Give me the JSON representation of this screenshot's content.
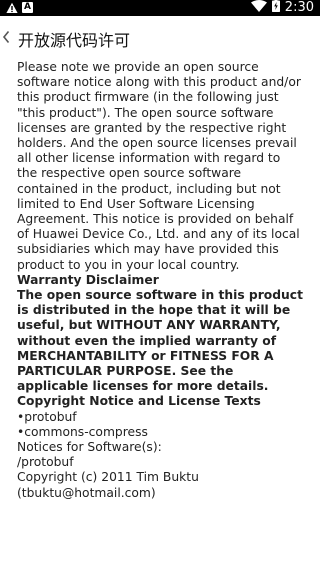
{
  "status_bar": {
    "time": "2:30",
    "left_icons": [
      "warning-icon",
      "a-notification-icon"
    ],
    "right_icons": [
      "wifi-icon",
      "battery-charging-icon"
    ]
  },
  "title_bar": {
    "title": "开放源代码许可",
    "back_glyph": "‹"
  },
  "content": {
    "notice": "Please note we provide an open source software notice along with this product and/or this product firmware (in the following just \"this product\"). The open source software licenses are granted by the respective right holders. And the open source licenses prevail all other license information with regard to the respective open source software contained in the product, including but not limited to End User Software Licensing Agreement. This notice is provided on behalf of Huawei Device Co., Ltd. and any of its local subsidiaries which may have provided this product to you in your local country.",
    "warranty_heading": "Warranty Disclaimer",
    "warranty_text": "The open source software in this product is distributed in the hope that it will be useful, but WITHOUT ANY WARRANTY, without even the implied warranty of MERCHANTABILITY or FITNESS FOR A PARTICULAR PURPOSE. See the applicable licenses for more details.",
    "copyright_heading": "Copyright Notice and License Texts",
    "item_protobuf": "•protobuf",
    "item_commons": "•commons-compress",
    "notices_for": "Notices for Software(s):",
    "path_protobuf": "/protobuf",
    "copyright_line": "Copyright (c) 2011 Tim Buktu",
    "email_line": "(tbuktu@hotmail.com)"
  }
}
